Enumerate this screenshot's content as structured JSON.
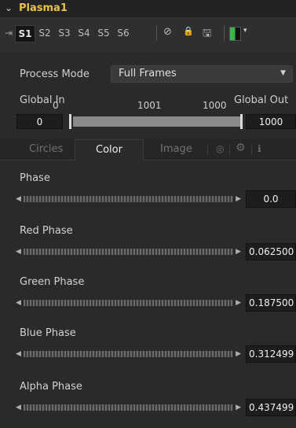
{
  "header": {
    "collapse_glyph": "⌄",
    "title": "Plasma1"
  },
  "toolbar": {
    "pin_icon": "⇥",
    "slots": [
      "S1",
      "S2",
      "S3",
      "S4",
      "S5",
      "S6"
    ],
    "icons": {
      "disable": "⊘",
      "lock": "🔒",
      "save": "🖫"
    },
    "swatch_colors": [
      "#3ab34a",
      "#111111"
    ],
    "swatch_arrow": "▾"
  },
  "process_mode": {
    "label": "Process Mode",
    "value": "Full Frames",
    "arrow": "▼"
  },
  "global_range": {
    "in_label": "Global In",
    "out_label": "Global Out",
    "start_value": "0",
    "mid_value": "1001",
    "end_value": "1000",
    "in_field": "0",
    "out_field": "1000"
  },
  "tabs": {
    "circles": "Circles",
    "color": "Color",
    "image": "Image",
    "settings_icon": "⚙",
    "info_icon": "ℹ",
    "camera_icon": "◎"
  },
  "controls": [
    {
      "label": "Phase",
      "value": "0.0"
    },
    {
      "label": "Red Phase",
      "value": "0.062500"
    },
    {
      "label": "Green Phase",
      "value": "0.187500"
    },
    {
      "label": "Blue Phase",
      "value": "0.312499"
    },
    {
      "label": "Alpha Phase",
      "value": "0.437499"
    }
  ],
  "slider_glyphs": {
    "left": "◀",
    "right": "▶"
  }
}
